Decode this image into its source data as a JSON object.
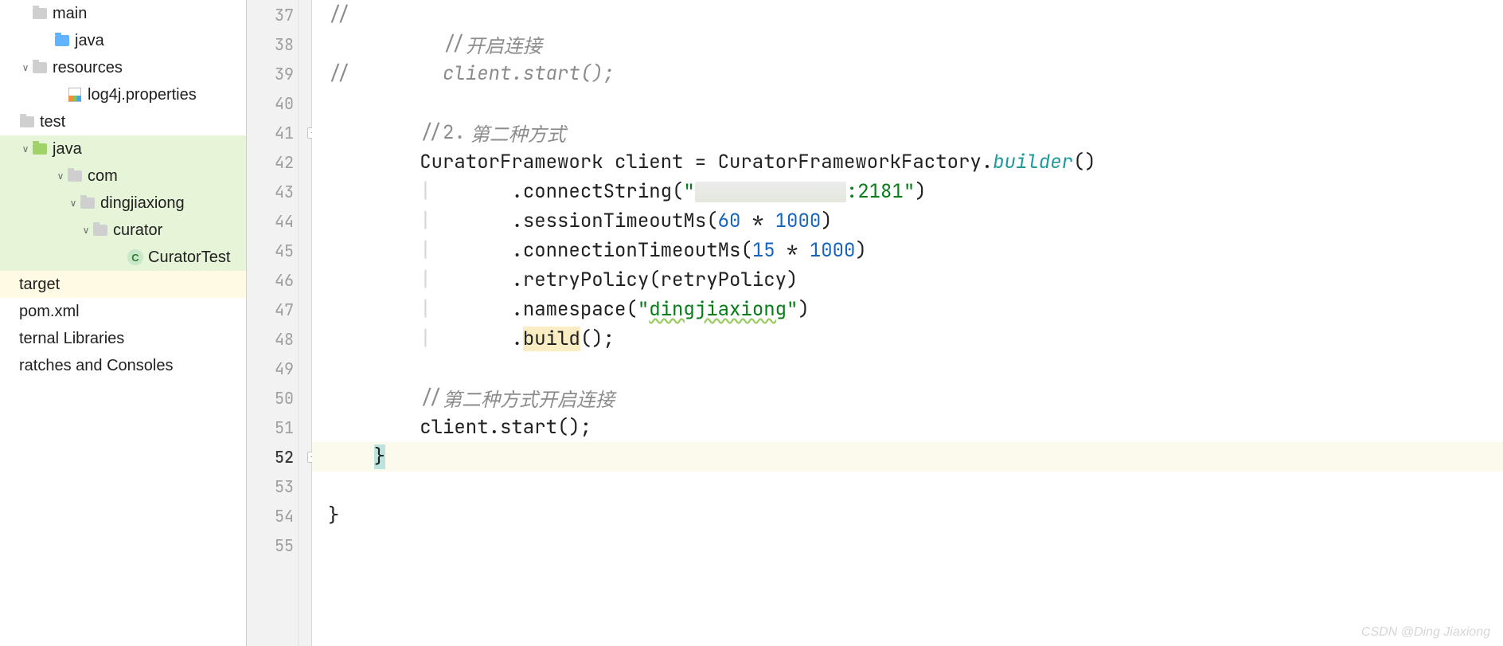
{
  "tree": {
    "rows": [
      {
        "indent": "ind1",
        "arrow": "",
        "iconClass": "fold-gray",
        "label": "main",
        "hl": "",
        "interact": true,
        "name": "tree-item-main"
      },
      {
        "indent": "ind2",
        "arrow": "",
        "iconClass": "fold-blue",
        "label": "java",
        "hl": "",
        "interact": true,
        "name": "tree-item-java-main"
      },
      {
        "indent": "ind1",
        "arrow": "∨",
        "iconClass": "fold-gray",
        "iconOverlay": "res",
        "label": "resources",
        "hl": "",
        "interact": true,
        "name": "tree-item-resources"
      },
      {
        "indent": "ind3",
        "arrow": "",
        "iconClass": "file-res",
        "label": "log4j.properties",
        "hl": "",
        "interact": true,
        "name": "tree-item-log4j"
      },
      {
        "indent": "ind0",
        "arrow": "",
        "iconClass": "fold-gray",
        "label": "test",
        "hl": "",
        "interact": true,
        "name": "tree-item-test"
      },
      {
        "indent": "ind1",
        "arrow": "∨",
        "iconClass": "fold-green",
        "label": "java",
        "hl": "hl-green",
        "interact": true,
        "name": "tree-item-java-test"
      },
      {
        "indent": "ind3",
        "arrow": "∨",
        "iconClass": "fold-gray",
        "label": "com",
        "hl": "hl-green",
        "interact": true,
        "name": "tree-item-com"
      },
      {
        "indent": "ind4",
        "arrow": "∨",
        "iconClass": "fold-gray",
        "label": "dingjiaxiong",
        "hl": "hl-green",
        "interact": true,
        "name": "tree-item-dingjiaxiong"
      },
      {
        "indent": "ind5",
        "arrow": "∨",
        "iconClass": "fold-gray",
        "label": "curator",
        "hl": "hl-green",
        "interact": true,
        "name": "tree-item-curator"
      },
      {
        "indent": "ind7",
        "arrow": "",
        "iconClass": "class-icon",
        "iconText": "C",
        "label": "CuratorTest",
        "hl": "hl-green",
        "interact": true,
        "name": "tree-item-curatortest"
      },
      {
        "indent": "ind0",
        "arrow": "",
        "iconClass": "",
        "label": "target",
        "hl": "hl-yellow",
        "interact": true,
        "name": "tree-item-target"
      },
      {
        "indent": "ind0",
        "arrow": "",
        "iconClass": "",
        "label": "pom.xml",
        "hl": "",
        "interact": true,
        "name": "tree-item-pom"
      },
      {
        "indent": "ind0",
        "arrow": "",
        "iconClass": "",
        "label": "ternal Libraries",
        "hl": "",
        "interact": true,
        "name": "tree-item-external-libraries"
      },
      {
        "indent": "ind0",
        "arrow": "",
        "iconClass": "",
        "label": "ratches and Consoles",
        "hl": "",
        "interact": true,
        "name": "tree-item-scratches"
      }
    ]
  },
  "gutter": {
    "start": 37,
    "end": 55,
    "current": 52,
    "fold_markers": [
      41,
      52
    ]
  },
  "code": {
    "l37": {
      "slashes": "//"
    },
    "l38": {
      "c1": "//",
      "c2": "开启连接"
    },
    "l39": {
      "slashes": "//",
      "c1": "client.start();"
    },
    "l40": "",
    "l41": {
      "c1": "//2.",
      "c2": "第二种方式"
    },
    "l42": {
      "t1": "CuratorFramework client = CuratorFrameworkFactory.",
      "t2": "builder",
      "t3": "()"
    },
    "l43": {
      "t1": ".connectString(",
      "q1": "\"",
      "q2": ":2181\"",
      "t2": ")"
    },
    "l44": {
      "t1": ".sessionTimeoutMs(",
      "n1": "60",
      "t2": " * ",
      "n2": "1000",
      "t3": ")"
    },
    "l45": {
      "t1": ".connectionTimeoutMs(",
      "n1": "15",
      "t2": " * ",
      "n2": "1000",
      "t3": ")"
    },
    "l46": {
      "t1": ".retryPolicy(retryPolicy)"
    },
    "l47": {
      "t1": ".namespace(",
      "q1": "\"",
      "s": "dingjiaxiong",
      "q2": "\"",
      "t2": ")"
    },
    "l48": {
      "t1": ".",
      "t2": "build",
      "t3": "();"
    },
    "l49": "",
    "l50": {
      "c1": "//",
      "c2": "第二种方式开启连接"
    },
    "l51": {
      "t1": "client.start();"
    },
    "l52": {
      "t1": "}"
    },
    "l53": "",
    "l54": {
      "t1": "}"
    },
    "l55": ""
  },
  "watermark": "CSDN @Ding Jiaxiong"
}
